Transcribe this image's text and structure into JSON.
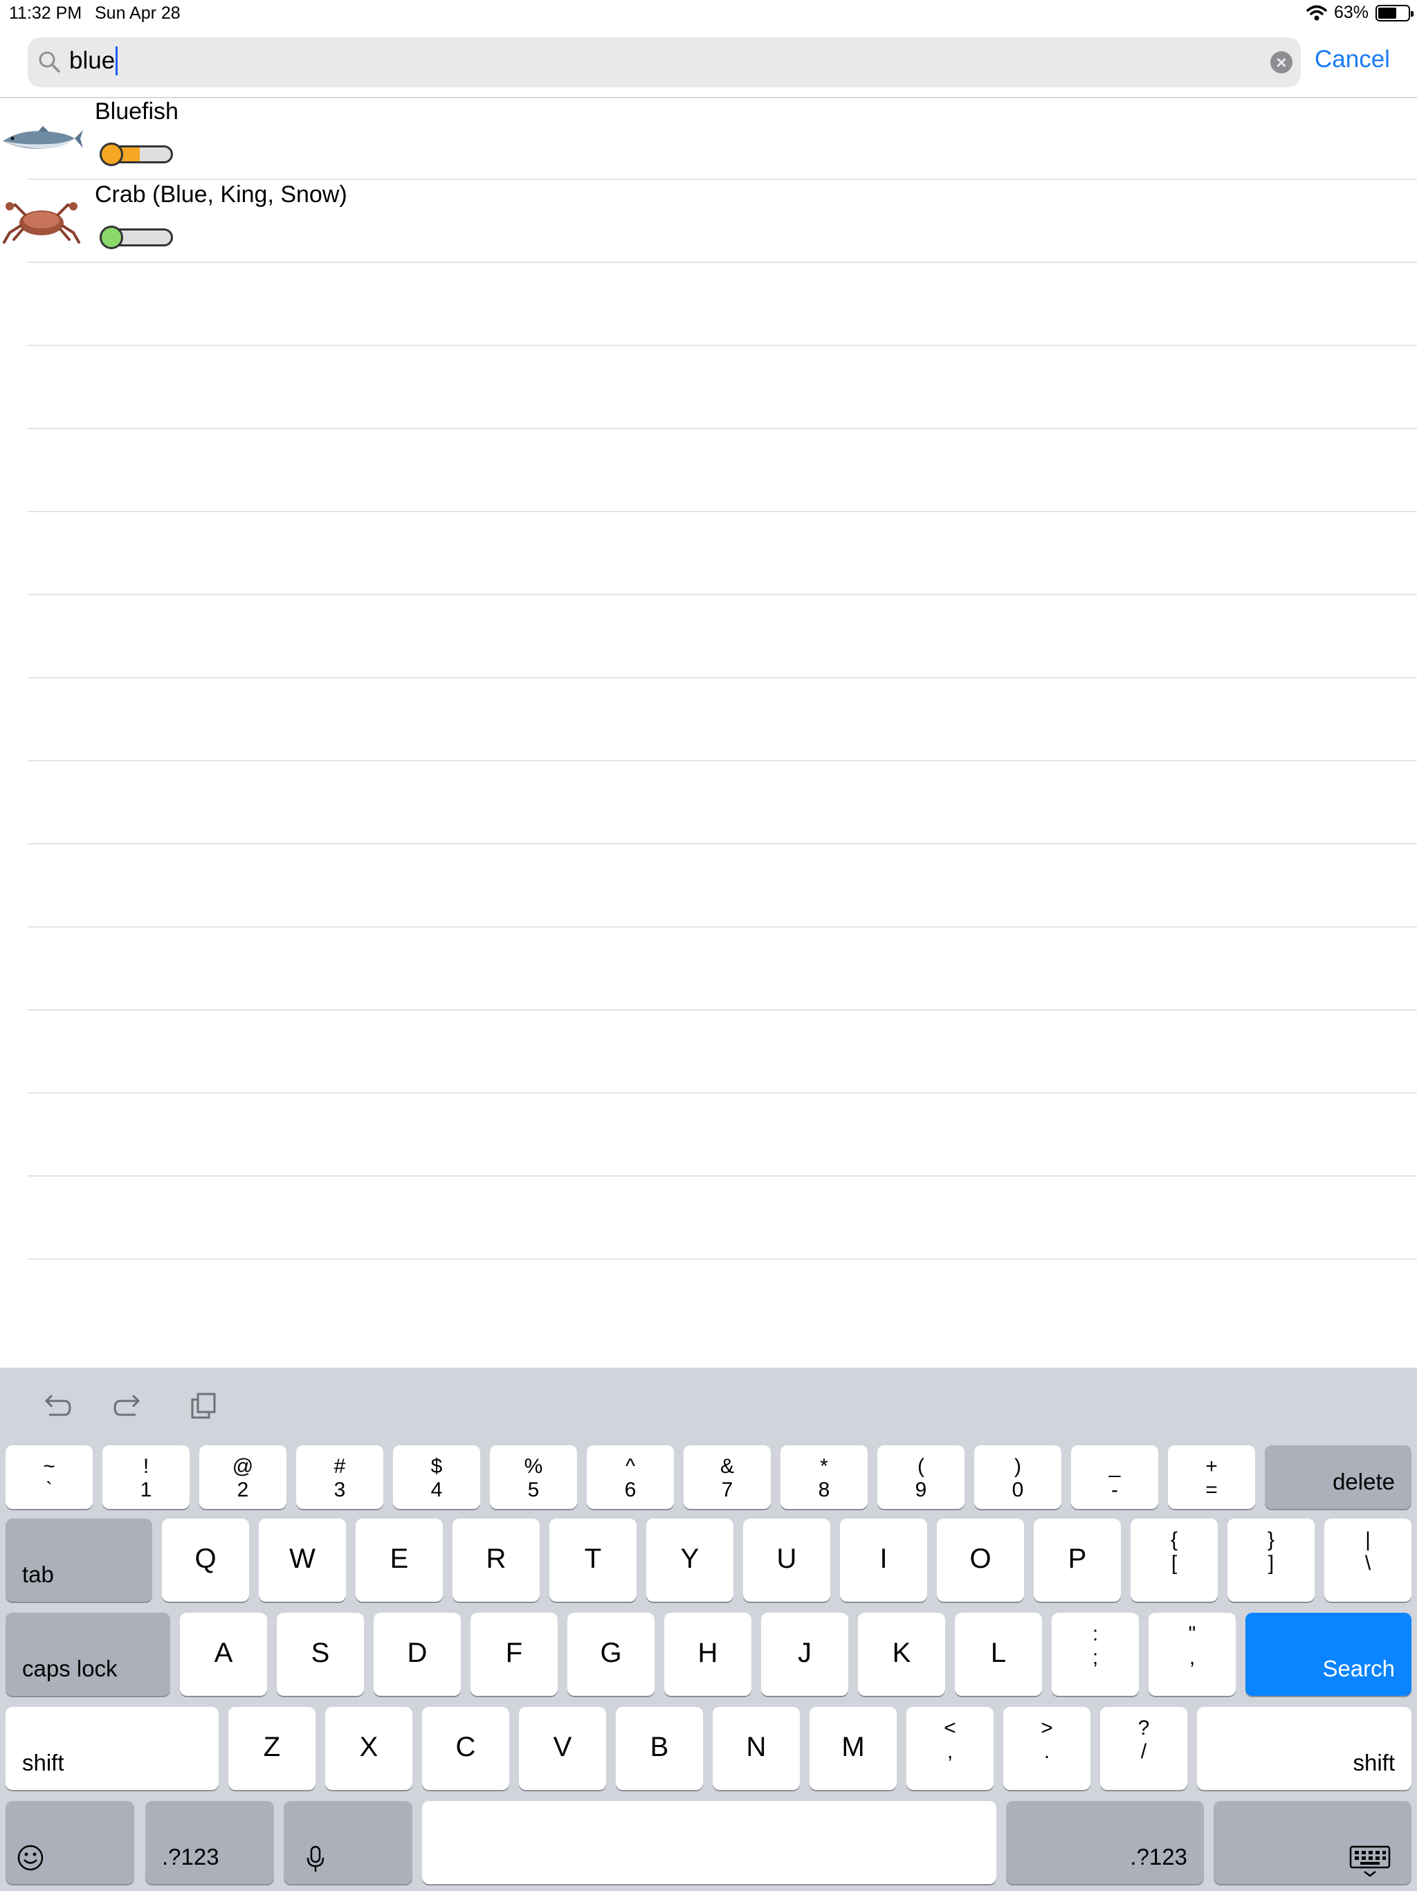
{
  "status": {
    "time": "11:32 PM",
    "date": "Sun Apr 28",
    "battery_percent": "63%",
    "battery_level": 0.63
  },
  "search": {
    "query": "blue",
    "cancel_label": "Cancel"
  },
  "results": [
    {
      "title": "Bluefish",
      "thumb_icon": "bluefish-image",
      "level": 0.55,
      "level_color": "#f5a623"
    },
    {
      "title": "Crab (Blue, King, Snow)",
      "thumb_icon": "crab-image",
      "level": 0.1,
      "level_color": "#8bd96a"
    }
  ],
  "keyboard": {
    "toolbar": [
      "undo-icon",
      "redo-icon",
      "paste-icon"
    ],
    "number_row": [
      {
        "top": "~",
        "bot": "`"
      },
      {
        "top": "!",
        "bot": "1"
      },
      {
        "top": "@",
        "bot": "2"
      },
      {
        "top": "#",
        "bot": "3"
      },
      {
        "top": "$",
        "bot": "4"
      },
      {
        "top": "%",
        "bot": "5"
      },
      {
        "top": "^",
        "bot": "6"
      },
      {
        "top": "&",
        "bot": "7"
      },
      {
        "top": "*",
        "bot": "8"
      },
      {
        "top": "(",
        "bot": "9"
      },
      {
        "top": ")",
        "bot": "0"
      },
      {
        "top": "_",
        "bot": "-"
      },
      {
        "top": "+",
        "bot": "="
      }
    ],
    "delete_label": "delete",
    "tab_label": "tab",
    "row_q": [
      "Q",
      "W",
      "E",
      "R",
      "T",
      "Y",
      "U",
      "I",
      "O",
      "P"
    ],
    "row_q_extra": [
      {
        "top": "{",
        "bot": "["
      },
      {
        "top": "}",
        "bot": "]"
      },
      {
        "top": "|",
        "bot": "\\"
      }
    ],
    "caps_label": "caps lock",
    "row_a": [
      "A",
      "S",
      "D",
      "F",
      "G",
      "H",
      "J",
      "K",
      "L"
    ],
    "row_a_extra": [
      {
        "top": ":",
        "bot": ";"
      },
      {
        "top": "\"",
        "bot": ","
      }
    ],
    "search_label": "Search",
    "shift_label": "shift",
    "row_z": [
      "Z",
      "X",
      "C",
      "V",
      "B",
      "N",
      "M"
    ],
    "row_z_extra": [
      {
        "top": "<",
        "bot": ","
      },
      {
        "top": ">",
        "bot": "."
      },
      {
        "top": "?",
        "bot": "/"
      }
    ],
    "numbers_label": ".?123"
  }
}
